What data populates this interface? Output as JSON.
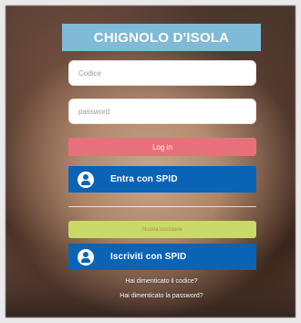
{
  "brand": {
    "title": "CHIGNOLO D'ISOLA",
    "title_bar_color": "#7fbad6"
  },
  "form": {
    "code_placeholder": "Codice",
    "password_placeholder": "password",
    "login_label": "Log in",
    "login_color": "#e8707b",
    "spid_login_label": "Entra con SPID",
    "spid_color": "#0b63b6",
    "register_label": "Nuova iscrizione",
    "register_color": "#c9d96a",
    "spid_register_label": "Iscriviti con SPID"
  },
  "links": {
    "forgot_code": "Hai dimenticato il codice?",
    "forgot_password": "Hai dimenticato la password?"
  },
  "icons": {
    "spid": "user-circle-icon"
  }
}
